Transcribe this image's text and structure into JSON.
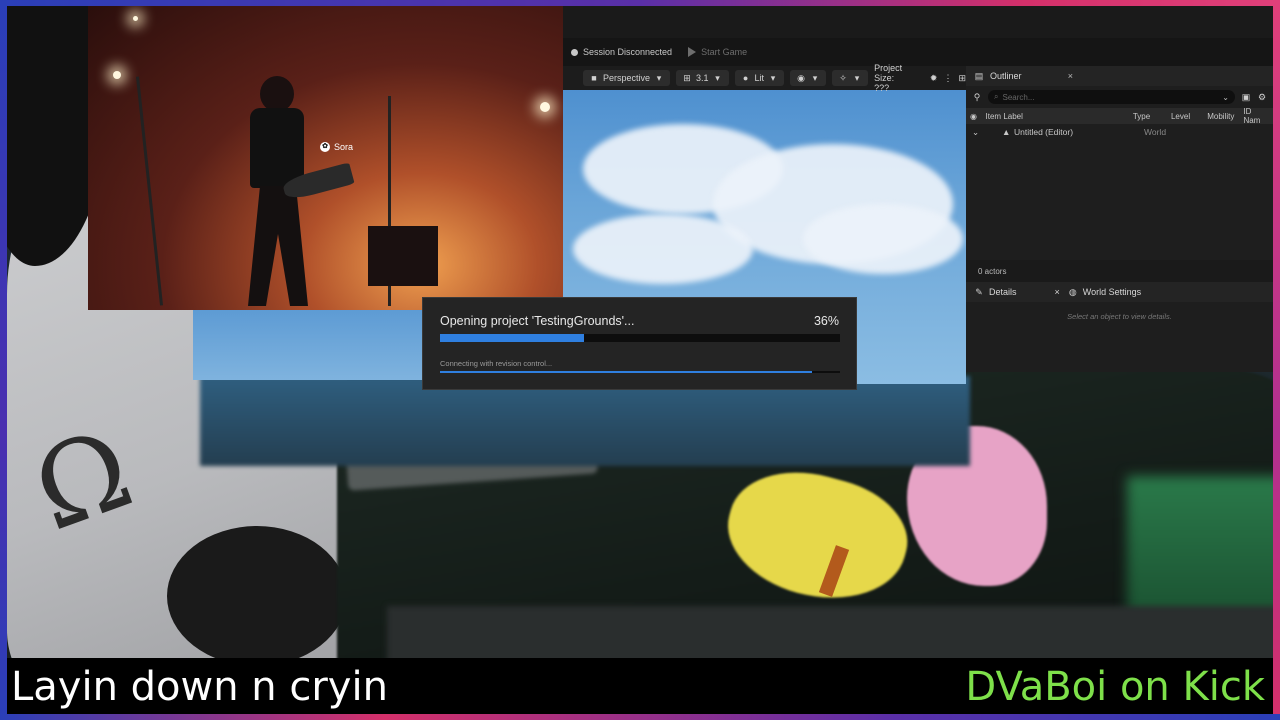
{
  "editor": {
    "session_status": "Session Disconnected",
    "start_game": "Start Game",
    "viewport": {
      "perspective": "Perspective",
      "fov": "3.1",
      "lit": "Lit",
      "project_size": "Project Size: ???"
    }
  },
  "outliner": {
    "tab": "Outliner",
    "close": "×",
    "search_placeholder": "Search...",
    "columns": [
      "Item Label",
      "Type",
      "Level",
      "Mobility",
      "ID Nam"
    ],
    "rows": [
      {
        "label": "Untitled (Editor)",
        "type": "World"
      }
    ],
    "actor_count": "0 actors"
  },
  "details": {
    "tab": "Details",
    "close": "×",
    "world_settings_tab": "World Settings",
    "hint": "Select an object to view details."
  },
  "loading_dialog": {
    "title": "Opening project 'TestingGrounds'...",
    "percent_label": "36%",
    "progress": 0.36,
    "subtask": "Connecting with revision control...",
    "subtask_progress": 0.93
  },
  "video_overlay": {
    "watermark": "Sora"
  },
  "caption": {
    "left": "Layin down n cryin",
    "right": "DVaBoi on Kick"
  },
  "colors": {
    "accent_blue": "#2f7fe0",
    "caption_green": "#7ee04a",
    "frame_blue": "#2a3fb8",
    "frame_pink": "#d4306a"
  }
}
